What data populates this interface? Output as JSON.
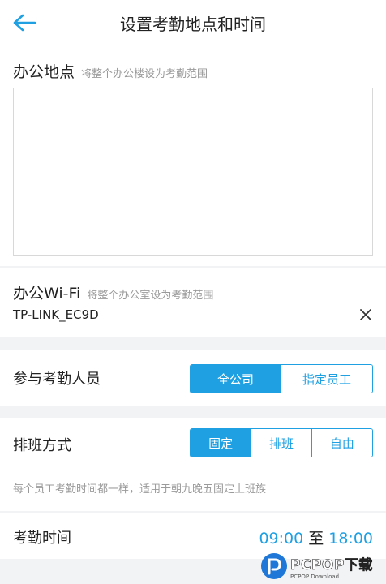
{
  "header": {
    "title": "设置考勤地点和时间"
  },
  "office": {
    "title": "办公地点",
    "hint": "将整个办公楼设为考勤范围"
  },
  "wifi": {
    "title": "办公Wi-Fi",
    "hint": "将整个办公室设为考勤范围",
    "ssid": "TP-LINK_EC9D"
  },
  "participants": {
    "label": "参与考勤人员",
    "options": [
      "全公司",
      "指定员工"
    ],
    "selected": "全公司"
  },
  "schedule": {
    "label": "排班方式",
    "options": [
      "固定",
      "排班",
      "自由"
    ],
    "selected": "固定",
    "description": "每个员工考勤时间都一样，适用于朝九晚五固定上班族"
  },
  "worktime": {
    "label": "考勤时间",
    "start": "09:00",
    "separator": "至",
    "end": "18:00"
  },
  "watermark": {
    "main": "PCPOP下载",
    "sub": "PCPOP Download"
  },
  "colors": {
    "accent": "#1fa0e3",
    "hint": "#9a9a9a",
    "background": "#f2f3f5"
  }
}
